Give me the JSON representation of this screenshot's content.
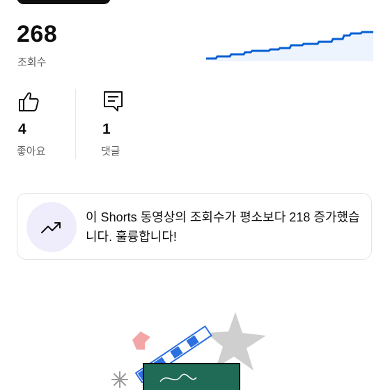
{
  "views": {
    "count": "268",
    "label": "조회수"
  },
  "sparkline": {
    "color": "#065fd4",
    "fill": "#eef4fd",
    "trend": "increasing"
  },
  "stats": [
    {
      "icon": "thumbs-up-icon",
      "value": "4",
      "label": "좋아요"
    },
    {
      "icon": "comment-icon",
      "value": "1",
      "label": "댓글"
    }
  ],
  "insight": {
    "icon": "trending-up-icon",
    "text": "이 Shorts 동영상의 조회수가 평소보다 218 증가했습니다. 훌륭합니다!"
  },
  "illustration": {
    "name": "clapperboard-illustration"
  }
}
